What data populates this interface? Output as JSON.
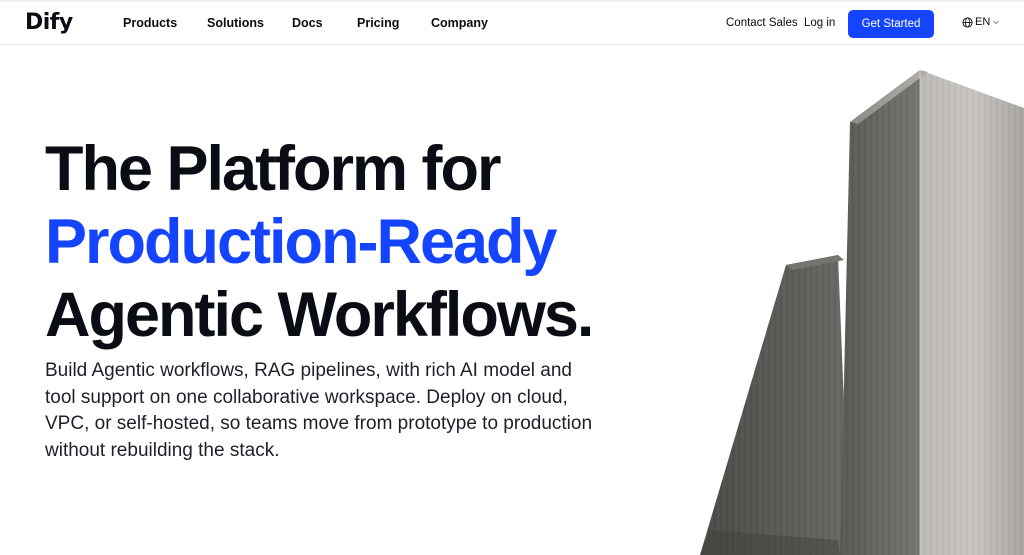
{
  "brand": {
    "logo_text": "Dify",
    "accent_color": "#1544ff"
  },
  "nav": {
    "items": [
      {
        "label": "Products"
      },
      {
        "label": "Solutions"
      },
      {
        "label": "Docs"
      },
      {
        "label": "Pricing"
      },
      {
        "label": "Company"
      }
    ],
    "contact_label": "Contact Sales",
    "login_label": "Log in",
    "cta_label": "Get Started",
    "language": {
      "label": "EN",
      "icon": "globe-icon",
      "caret_icon": "chevron-down-icon"
    }
  },
  "hero": {
    "title_line1": "The Platform for",
    "title_line2": "Production-Ready",
    "title_line3": "Agentic Workflows.",
    "subtitle": "Build Agentic workflows, RAG pipelines, with rich AI model and tool support on one collaborative workspace. Deploy on cloud, VPC, or self-hosted, so teams move from prototype to production without rebuilding the stack.",
    "image_description": "concrete-pillars-illustration"
  },
  "colors": {
    "text": "#0b0d14",
    "accent": "#1544ff",
    "background": "#ffffff"
  }
}
